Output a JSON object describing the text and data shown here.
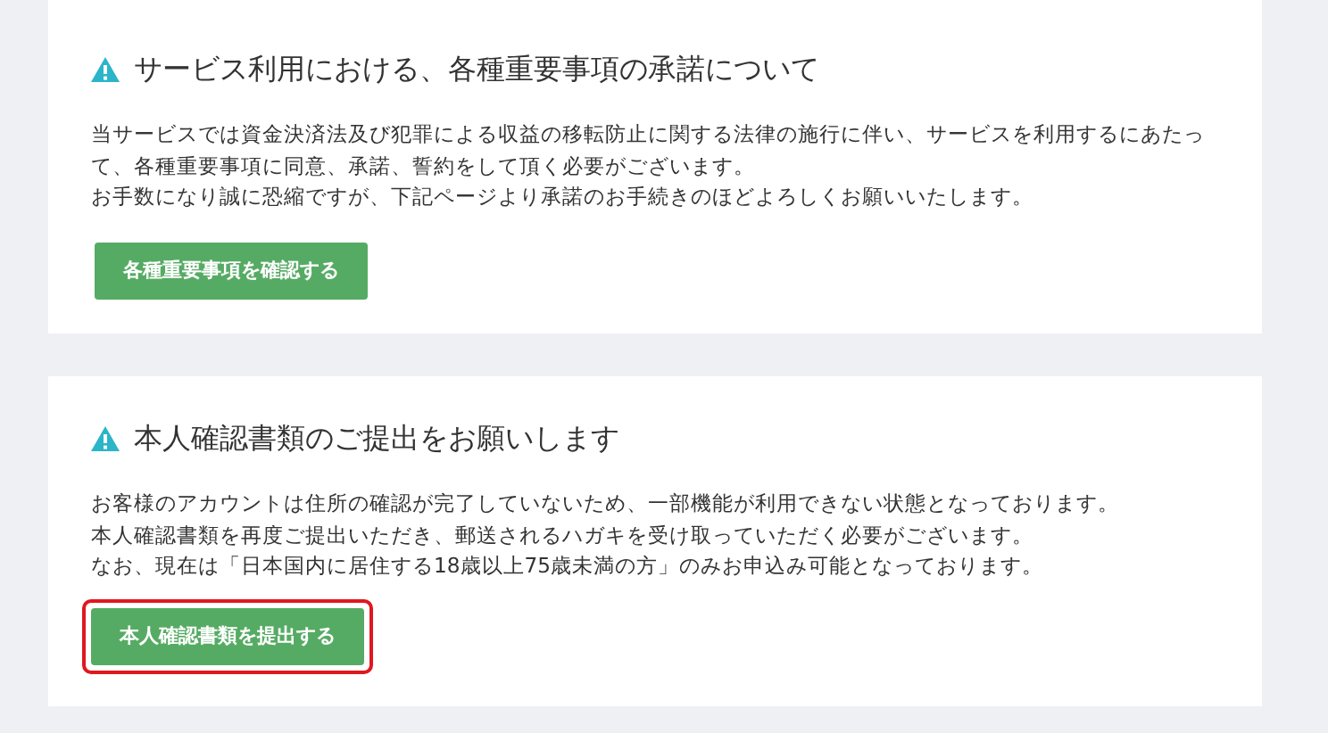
{
  "cards": [
    {
      "title": "サービス利用における、各種重要事項の承諾について",
      "paragraphs": [
        "当サービスでは資金決済法及び犯罪による収益の移転防止に関する法律の施行に伴い、サービスを利用するにあたって、各種重要事項に同意、承諾、誓約をして頂く必要がございます。",
        "お手数になり誠に恐縮ですが、下記ページより承諾のお手続きのほどよろしくお願いいたします。"
      ],
      "button": {
        "label": "各種重要事項を確認する",
        "highlighted": false
      }
    },
    {
      "title": "本人確認書類のご提出をお願いします",
      "paragraphs": [
        "お客様のアカウントは住所の確認が完了していないため、一部機能が利用できない状態となっております。",
        "本人確認書類を再度ご提出いただき、郵送されるハガキを受け取っていただく必要がございます。",
        "なお、現在は「日本国内に居住する18歳以上75歳未満の方」のみお申込み可能となっております。"
      ],
      "button": {
        "label": "本人確認書類を提出する",
        "highlighted": true
      }
    }
  ]
}
